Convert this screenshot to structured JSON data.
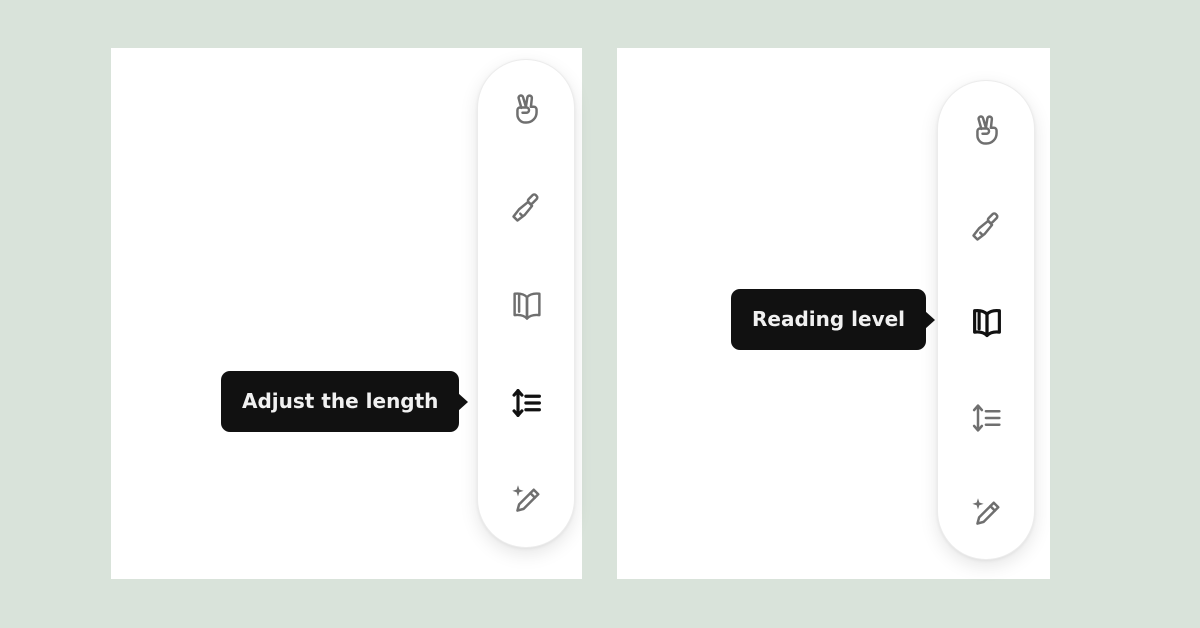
{
  "colors": {
    "background": "#d9e3da",
    "panel": "#ffffff",
    "icon_default": "#6f6f6f",
    "icon_active": "#111111",
    "tooltip_bg": "#111111",
    "tooltip_text": "#f1f1f1"
  },
  "panels": [
    {
      "tooltip": "Adjust the length",
      "active_tool": "adjust-length",
      "tools": [
        "peace-hand-icon",
        "paintbrush-icon",
        "open-book-icon",
        "adjust-length-icon",
        "sparkle-pencil-icon"
      ]
    },
    {
      "tooltip": "Reading level",
      "active_tool": "reading-level",
      "tools": [
        "peace-hand-icon",
        "paintbrush-icon",
        "open-book-icon",
        "adjust-length-icon",
        "sparkle-pencil-icon"
      ]
    }
  ]
}
